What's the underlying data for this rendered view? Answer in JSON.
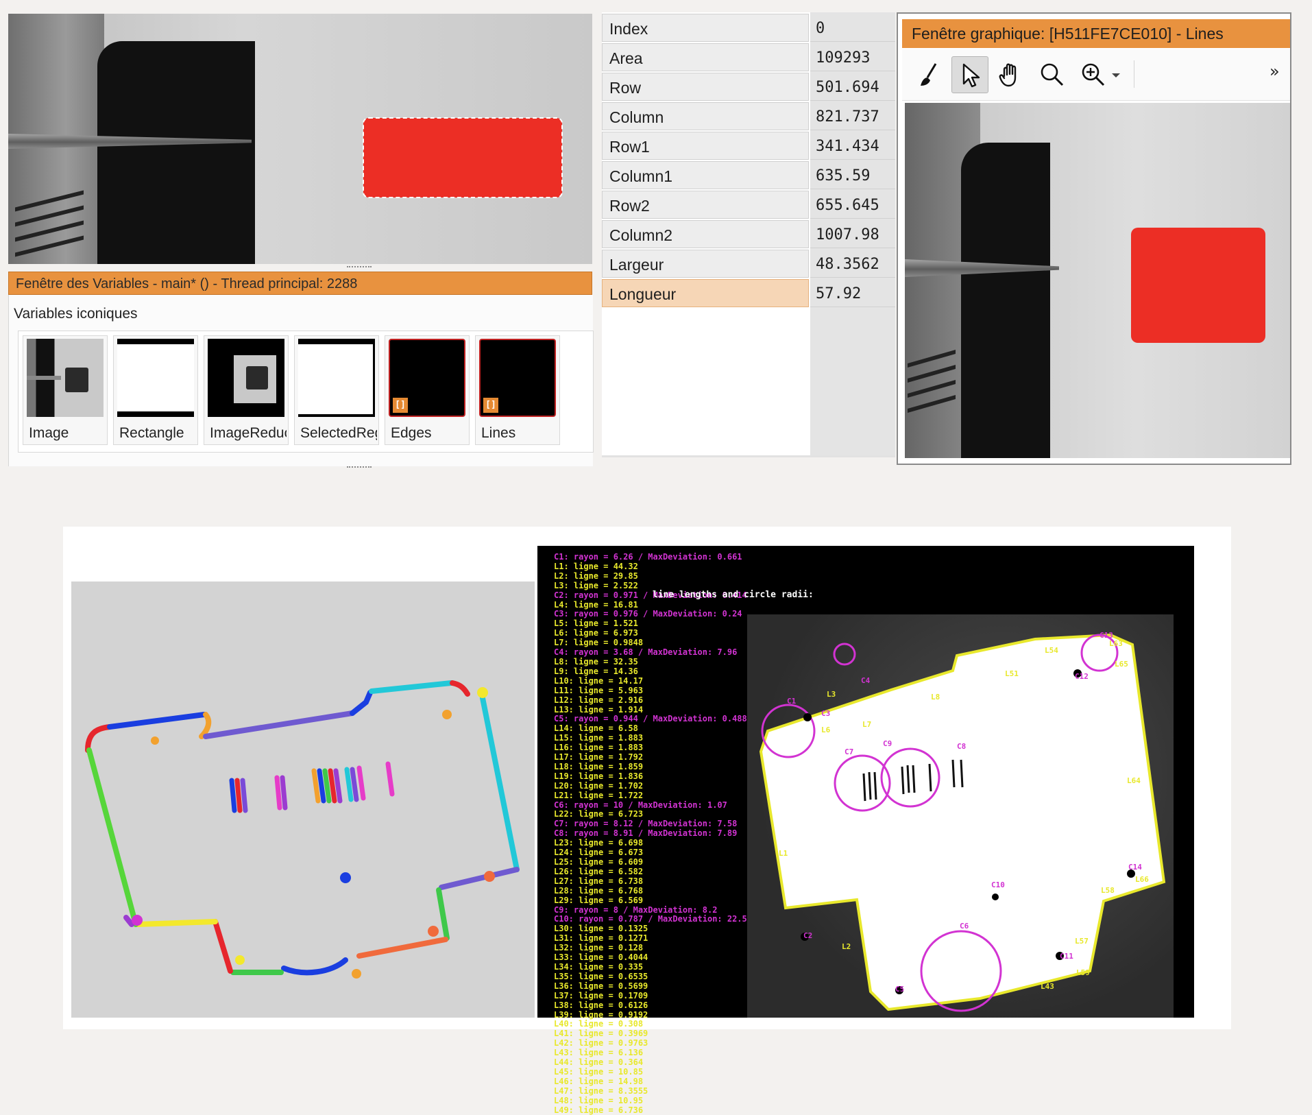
{
  "properties_panel": {
    "rows": [
      {
        "key": "Index",
        "value": "0"
      },
      {
        "key": "Area",
        "value": "109293"
      },
      {
        "key": "Row",
        "value": "501.694"
      },
      {
        "key": "Column",
        "value": "821.737"
      },
      {
        "key": "Row1",
        "value": "341.434"
      },
      {
        "key": "Column1",
        "value": "635.59"
      },
      {
        "key": "Row2",
        "value": "655.645"
      },
      {
        "key": "Column2",
        "value": "1007.98"
      },
      {
        "key": "Largeur",
        "value": "48.3562"
      },
      {
        "key": "Longueur",
        "value": "57.92"
      }
    ],
    "selected_key": "Longueur"
  },
  "variables_window": {
    "title": "Fenêtre des Variables - main* () - Thread principal: 2288",
    "section_label": "Variables iconiques",
    "items": [
      {
        "label": "Image",
        "kind": "image"
      },
      {
        "label": "Rectangle",
        "kind": "region"
      },
      {
        "label": "ImageReduced",
        "kind": "image"
      },
      {
        "label": "SelectedRegions",
        "kind": "region"
      },
      {
        "label": "Edges",
        "kind": "tuple"
      },
      {
        "label": "Lines",
        "kind": "tuple"
      }
    ],
    "tuple_badge": "[]"
  },
  "graphics_window": {
    "title": "Fenêtre graphique: [H511FE7CE010] - Lines",
    "tools": [
      "clear-brush-icon",
      "pointer-icon",
      "pan-hand-icon",
      "magnify-icon",
      "zoom-in-icon",
      "dropdown-arrow-icon"
    ],
    "active_tool": "pointer-icon",
    "overflow_label": "»"
  },
  "measurement_view": {
    "overlay_title": "line lengths and circle radii:",
    "log_lines": [
      {
        "t": "C1: rayon = 6.26 / MaxDeviation: 0.661",
        "k": "r"
      },
      {
        "t": "L1: ligne = 44.32",
        "k": "l"
      },
      {
        "t": "L2: ligne = 29.85",
        "k": "l"
      },
      {
        "t": "L3: ligne = 2.522",
        "k": "l"
      },
      {
        "t": "C2: rayon = 0.971 / MaxDeviation: 0.414",
        "k": "r"
      },
      {
        "t": "L4: ligne = 16.81",
        "k": "l"
      },
      {
        "t": "C3: rayon = 0.976 / MaxDeviation: 0.24",
        "k": "r"
      },
      {
        "t": "L5: ligne = 1.521",
        "k": "l"
      },
      {
        "t": "L6: ligne = 6.973",
        "k": "l"
      },
      {
        "t": "L7: ligne = 0.9848",
        "k": "l"
      },
      {
        "t": "C4: rayon = 3.68 / MaxDeviation: 7.96",
        "k": "r"
      },
      {
        "t": "L8: ligne = 32.35",
        "k": "l"
      },
      {
        "t": "L9: ligne = 14.36",
        "k": "l"
      },
      {
        "t": "L10: ligne = 14.17",
        "k": "l"
      },
      {
        "t": "L11: ligne = 5.963",
        "k": "l"
      },
      {
        "t": "L12: ligne = 2.916",
        "k": "l"
      },
      {
        "t": "L13: ligne = 1.914",
        "k": "l"
      },
      {
        "t": "C5: rayon = 0.944 / MaxDeviation: 0.488",
        "k": "r"
      },
      {
        "t": "L14: ligne = 6.58",
        "k": "l"
      },
      {
        "t": "L15: ligne = 1.883",
        "k": "l"
      },
      {
        "t": "L16: ligne = 1.883",
        "k": "l"
      },
      {
        "t": "L17: ligne = 1.792",
        "k": "l"
      },
      {
        "t": "L18: ligne = 1.859",
        "k": "l"
      },
      {
        "t": "L19: ligne = 1.836",
        "k": "l"
      },
      {
        "t": "L20: ligne = 1.702",
        "k": "l"
      },
      {
        "t": "L21: ligne = 1.722",
        "k": "l"
      },
      {
        "t": "C6: rayon = 10 / MaxDeviation: 1.07",
        "k": "r"
      },
      {
        "t": "L22: ligne = 6.723",
        "k": "l"
      },
      {
        "t": "C7: rayon = 8.12 / MaxDeviation: 7.58",
        "k": "r"
      },
      {
        "t": "C8: rayon = 8.91 / MaxDeviation: 7.89",
        "k": "r"
      },
      {
        "t": "L23: ligne = 6.698",
        "k": "l"
      },
      {
        "t": "L24: ligne = 6.673",
        "k": "l"
      },
      {
        "t": "L25: ligne = 6.609",
        "k": "l"
      },
      {
        "t": "L26: ligne = 6.582",
        "k": "l"
      },
      {
        "t": "L27: ligne = 6.738",
        "k": "l"
      },
      {
        "t": "L28: ligne = 6.768",
        "k": "l"
      },
      {
        "t": "L29: ligne = 6.569",
        "k": "l"
      },
      {
        "t": "C9: rayon = 8 / MaxDeviation: 8.2",
        "k": "r"
      },
      {
        "t": "C10: rayon = 0.787 / MaxDeviation: 22.5",
        "k": "r"
      },
      {
        "t": "L30: ligne = 0.1325",
        "k": "l"
      },
      {
        "t": "L31: ligne = 0.1271",
        "k": "l"
      },
      {
        "t": "L32: ligne = 0.128",
        "k": "l"
      },
      {
        "t": "L33: ligne = 0.4044",
        "k": "l"
      },
      {
        "t": "L34: ligne = 0.335",
        "k": "l"
      },
      {
        "t": "L35: ligne = 0.6535",
        "k": "l"
      },
      {
        "t": "L36: ligne = 0.5699",
        "k": "l"
      },
      {
        "t": "L37: ligne = 0.1709",
        "k": "l"
      },
      {
        "t": "L38: ligne = 0.6126",
        "k": "l"
      },
      {
        "t": "L39: ligne = 0.9192",
        "k": "l"
      },
      {
        "t": "L40: ligne = 0.308",
        "k": "l"
      },
      {
        "t": "L41: ligne = 0.3969",
        "k": "l"
      },
      {
        "t": "L42: ligne = 0.9763",
        "k": "l"
      },
      {
        "t": "L43: ligne = 6.136",
        "k": "l"
      },
      {
        "t": "L44: ligne = 0.364",
        "k": "l"
      },
      {
        "t": "L45: ligne = 10.85",
        "k": "l"
      },
      {
        "t": "L46: ligne = 14.98",
        "k": "l"
      },
      {
        "t": "L47: ligne = 8.3555",
        "k": "l"
      },
      {
        "t": "L48: ligne = 10.95",
        "k": "l"
      },
      {
        "t": "L49: ligne = 6.736",
        "k": "l"
      }
    ],
    "labels": [
      {
        "id": "C1",
        "k": "m"
      },
      {
        "id": "C3",
        "k": "m"
      },
      {
        "id": "L6",
        "k": "y"
      },
      {
        "id": "L7",
        "k": "y"
      },
      {
        "id": "L3",
        "k": "y"
      },
      {
        "id": "C4",
        "k": "m"
      },
      {
        "id": "L8",
        "k": "y"
      },
      {
        "id": "L51",
        "k": "y"
      },
      {
        "id": "L54",
        "k": "y"
      },
      {
        "id": "C13",
        "k": "m"
      },
      {
        "id": "L63",
        "k": "y"
      },
      {
        "id": "L65",
        "k": "y"
      },
      {
        "id": "C12",
        "k": "m"
      },
      {
        "id": "L64",
        "k": "y"
      },
      {
        "id": "C7",
        "k": "m"
      },
      {
        "id": "C9",
        "k": "m"
      },
      {
        "id": "C8",
        "k": "m"
      },
      {
        "id": "L1",
        "k": "y"
      },
      {
        "id": "C10",
        "k": "m"
      },
      {
        "id": "C14",
        "k": "m"
      },
      {
        "id": "L66",
        "k": "y"
      },
      {
        "id": "L58",
        "k": "y"
      },
      {
        "id": "C2",
        "k": "m"
      },
      {
        "id": "L2",
        "k": "y"
      },
      {
        "id": "C6",
        "k": "m"
      },
      {
        "id": "L57",
        "k": "y"
      },
      {
        "id": "C11",
        "k": "m"
      },
      {
        "id": "L59",
        "k": "y"
      },
      {
        "id": "C5",
        "k": "m"
      },
      {
        "id": "L43",
        "k": "y"
      }
    ]
  },
  "colors": {
    "accent_orange": "#e8923f",
    "region_red": "#ec2e25",
    "overlay_yellow": "#e8e82c",
    "overlay_magenta": "#d233d2"
  }
}
